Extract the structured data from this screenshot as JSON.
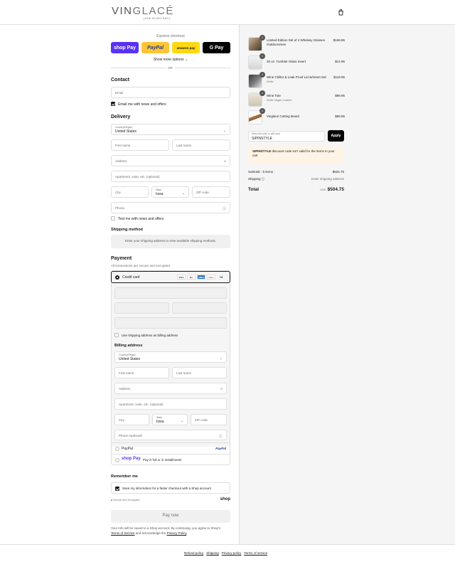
{
  "brand": {
    "name_a": "VIN",
    "name_b": "GLACÉ",
    "tagline": "(VIN-GLAH-SAY)"
  },
  "express": {
    "title": "Express checkout",
    "buttons": [
      {
        "label": "shop Pay",
        "bg": "#5a31f4",
        "fg": "#ffffff"
      },
      {
        "label": "PayPal",
        "bg": "#ffc439",
        "fg": "#253b80"
      },
      {
        "label": "amazon pay",
        "bg": "#ffd814",
        "fg": "#111111"
      },
      {
        "label": "G Pay",
        "bg": "#000000",
        "fg": "#ffffff"
      }
    ],
    "show_more": "Show more options ⌄",
    "or": "OR"
  },
  "contact": {
    "title": "Contact",
    "email_placeholder": "Email",
    "news_label": "Email me with news and offers"
  },
  "delivery": {
    "title": "Delivery",
    "country_label": "Country/Region",
    "country_value": "United States",
    "first_name": "First name",
    "last_name": "Last name",
    "address": "Address",
    "apartment": "Apartment, suite, etc. (optional)",
    "city": "City",
    "state_label": "State",
    "state_value": "Iowa",
    "zip": "ZIP code",
    "phone": "Phone",
    "text_label": "Text me with news and offers"
  },
  "shipping": {
    "title": "Shipping method",
    "message": "Enter your shipping address to view available shipping methods."
  },
  "payment": {
    "title": "Payment",
    "subtitle": "All transactions are secure and encrypted.",
    "credit_card": "Credit card",
    "cards": [
      "VISA",
      "MC",
      "AMEX",
      "DISC"
    ],
    "more_cards": "+4",
    "use_shipping": "Use shipping address as billing address",
    "billing_title": "Billing address",
    "billing_phone": "Phone (optional)",
    "paypal": "PayPal",
    "paypal_logo": "PayPal",
    "shoppay_logo": "shop Pay",
    "shoppay_text": "Pay in full or in installments"
  },
  "remember": {
    "title": "Remember me",
    "save_label": "Save my information for a faster checkout with a Shop account",
    "secure": "Secure and encrypted",
    "shop": "shop"
  },
  "pay_now": "Pay now",
  "legal": {
    "line1": "Your info will be saved to a Shop account. By continuing, you agree to Shop's",
    "terms": "Terms of Service",
    "and": " and acknowledge the ",
    "privacy": "Privacy Policy",
    "end": "."
  },
  "footer": {
    "links": [
      "Refund policy",
      "Shipping",
      "Privacy policy",
      "Terms of service"
    ]
  },
  "cart": {
    "items": [
      {
        "qty": "1",
        "name": "Limited Edition Set of 4 Whiskey Glasses Outdoorsmen",
        "sub": "",
        "price": "$169.95"
      },
      {
        "qty": "1",
        "name": "20 oz. Tumbler Glass Insert",
        "sub": "",
        "price": "$14.95"
      },
      {
        "qty": "1",
        "name": "Wine Chiller & Leak Proof Lid w/Insert Set",
        "sub": "White",
        "price": "$119.95"
      },
      {
        "qty": "1",
        "name": "Wine Tote",
        "sub": "White Vegan Leather",
        "price": "$99.95"
      },
      {
        "qty": "1",
        "name": "Vinglacé Cutting Board",
        "sub": "",
        "price": "$99.95"
      }
    ],
    "discount_label": "Discount code or gift card",
    "discount_value": "SIPINSTYLE",
    "apply": "Apply",
    "alert_code": "SIPINSTYLE",
    "alert_text": " discount code isn't valid for the items in your cart",
    "subtotal_label": "Subtotal · 5 items",
    "subtotal_value": "$504.75",
    "shipping_label": "Shipping ⓘ",
    "shipping_value": "Enter shipping address",
    "total_label": "Total",
    "currency": "USD",
    "total_value": "$504.75"
  }
}
